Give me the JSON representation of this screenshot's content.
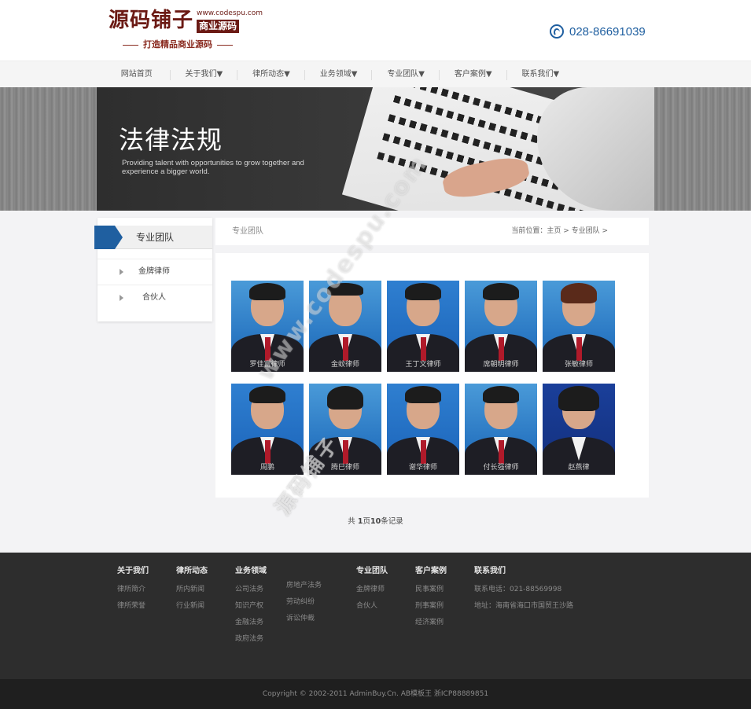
{
  "logo": {
    "main": "源码铺子",
    "url": "www.codespu.com",
    "badge": "商业源码",
    "slogan": "打造精品商业源码"
  },
  "phone": "028-86691039",
  "nav": {
    "items": [
      "网站首页",
      "关于我们▼",
      "律所动态▼",
      "业务领域▼",
      "专业团队▼",
      "客户案例▼",
      "联系我们▼"
    ]
  },
  "banner": {
    "title": "法律法规",
    "subtitle": "Providing talent with opportunities to grow together and experience a bigger world."
  },
  "sidebar": {
    "title": "专业团队",
    "items": [
      "金牌律师",
      "合伙人"
    ]
  },
  "breadcrumb": {
    "section": "专业团队",
    "location": "当前位置：主页 > 专业团队 >"
  },
  "team": [
    {
      "name": "罗佳富律师"
    },
    {
      "name": "金蚊律师"
    },
    {
      "name": "王丁文律师"
    },
    {
      "name": "席朝明律师"
    },
    {
      "name": "张敏律师"
    },
    {
      "name": "周鹏"
    },
    {
      "name": "腾巳律师"
    },
    {
      "name": "谢华律师"
    },
    {
      "name": "付长强律师"
    },
    {
      "name": "赵燕律"
    }
  ],
  "pager": {
    "prefix": "共",
    "pages": "1",
    "middle": "页",
    "count": "10",
    "suffix": "条记录"
  },
  "footer": {
    "about": {
      "title": "关于我们",
      "links": [
        "律所简介",
        "律所荣誉"
      ]
    },
    "news": {
      "title": "律所动态",
      "links": [
        "所内新闻",
        "行业新闻"
      ]
    },
    "business": {
      "title": "业务领域",
      "links_a": [
        "公司法务",
        "知识产权",
        "金融法务",
        "政府法务"
      ],
      "links_b": [
        "房地产法务",
        "劳动纠纷",
        "诉讼仲裁"
      ]
    },
    "team": {
      "title": "专业团队",
      "links": [
        "金牌律师",
        "合伙人"
      ]
    },
    "cases": {
      "title": "客户案例",
      "links": [
        "民事案例",
        "刑事案例",
        "经济案例"
      ]
    },
    "contact": {
      "title": "联系我们",
      "phone": "联系电话：021-88569998",
      "address": "地址：海南省海口市国贸王沙路"
    }
  },
  "copyright": "Copyright © 2002-2011 AdminBuy.Cn. AB模板王 浙ICP88889851",
  "watermark": {
    "text1": "www.codespu.com",
    "text2": "源码铺子"
  },
  "colors": {
    "brand": "#6b1a14",
    "accent": "#1f5fa0",
    "footer": "#2d2d2d"
  }
}
